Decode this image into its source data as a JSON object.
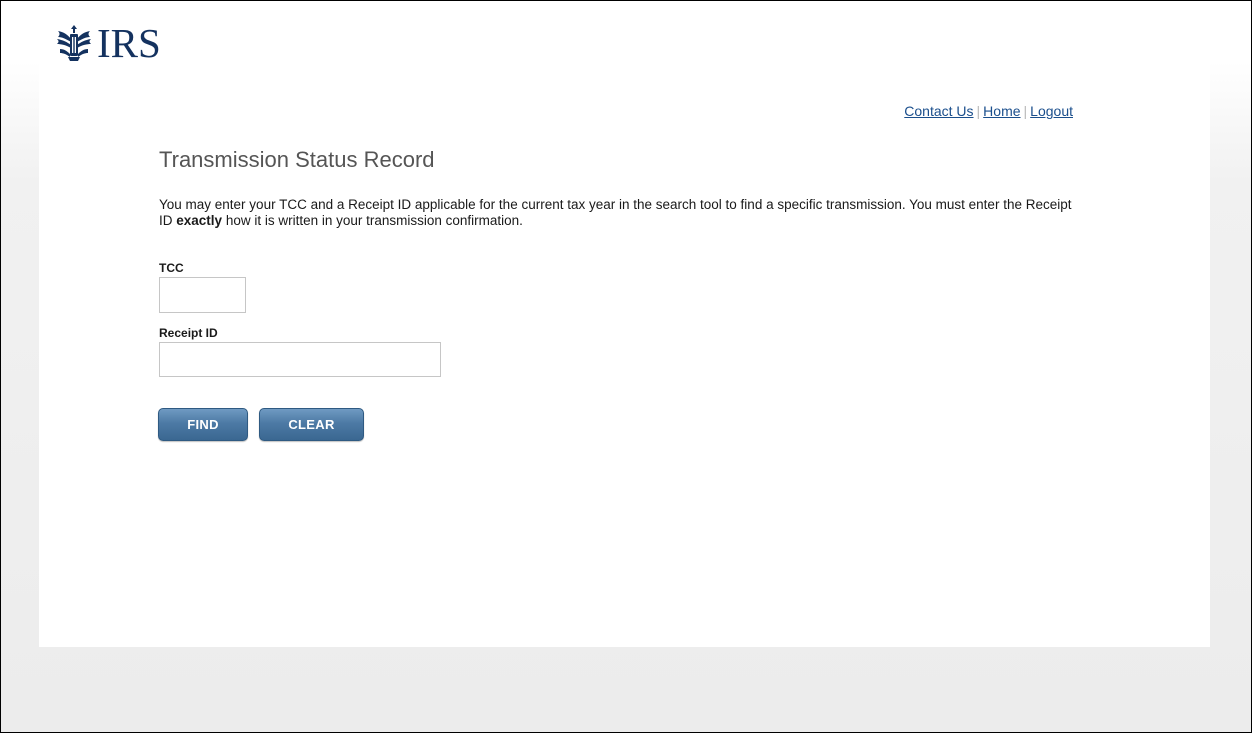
{
  "header": {
    "logo_text": "IRS",
    "logo_icon": "irs-eagle-icon"
  },
  "nav": {
    "contact_us": "Contact Us",
    "home": "Home",
    "logout": "Logout",
    "separator": "|"
  },
  "page": {
    "title": "Transmission Status Record",
    "description_part1": "You may enter your TCC and a Receipt ID applicable for the current tax year in the search tool to find a specific transmission. You must enter the Receipt ID ",
    "description_bold": "exactly",
    "description_part2": " how it is written in your transmission confirmation."
  },
  "form": {
    "tcc_label": "TCC",
    "tcc_value": "",
    "receipt_label": "Receipt ID",
    "receipt_value": "",
    "find_label": "FIND",
    "clear_label": "CLEAR"
  },
  "colors": {
    "brand_navy": "#14325f",
    "link": "#1a4e8c",
    "button": "#4d7aa5"
  }
}
